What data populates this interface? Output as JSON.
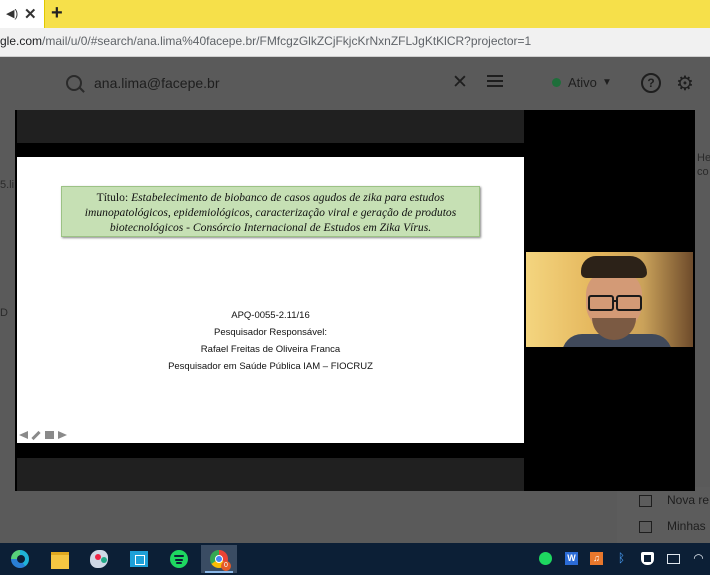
{
  "browser": {
    "tab_audio_icon": "speaker-icon",
    "tab_close": "✕",
    "new_tab": "+",
    "url_host": "gle.com",
    "url_path": "/mail/u/0/#search/ana.lima%40facepe.br/FMfcgzGlkZCjFkjcKrNxnZFLJgKtKlCR?projector=1"
  },
  "gmail": {
    "search_value": "ana.lima@facepe.br",
    "clear_symbol": "✕",
    "status_label": "Ativo",
    "status_color": "#1e6e3a",
    "help_symbol": "?",
    "settings_symbol": "⚙",
    "side_fragments": [
      "5.li",
      "D",
      "He",
      "co"
    ],
    "right_panel": {
      "items": [
        "Nova re",
        "Minhas"
      ]
    }
  },
  "slide": {
    "title_label": "Título:",
    "title_text": "Estabelecimento de biobanco de casos agudos de zika para estudos imunopatológicos, epidemiológicos, caracterização viral e geração de produtos biotecnológicos - Consórcio Internacional de Estudos em Zika Vírus.",
    "code": "APQ-0055-2.11/16",
    "role_label": "Pesquisador Responsável:",
    "researcher": "Rafael Freitas de Oliveira Franca",
    "affiliation": "Pesquisador em Saúde Pública IAM – FIOCRUZ",
    "title_bg": "#c6e0b4"
  },
  "taskbar": {
    "apps": [
      "edge",
      "file-explorer",
      "paint",
      "store",
      "spotify",
      "chrome"
    ],
    "chrome_badge": "0",
    "tray": {
      "word": "W",
      "sound": "♫",
      "bluetooth": "ᛒ",
      "wifi": "◠"
    }
  }
}
